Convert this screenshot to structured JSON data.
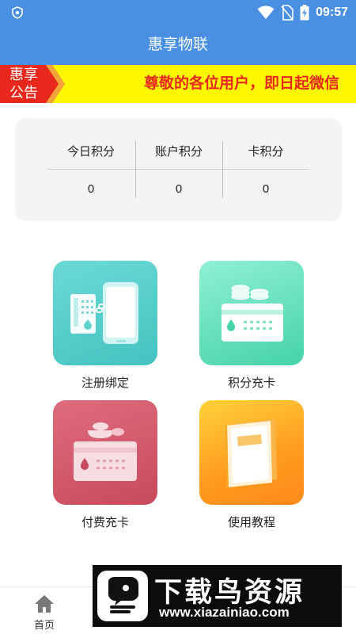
{
  "status_bar": {
    "time": "09:57"
  },
  "app": {
    "title": "惠享物联"
  },
  "notice": {
    "badge": "惠享 公告",
    "text": "尊敬的各位用户，即日起微信"
  },
  "points": {
    "columns": [
      {
        "label": "今日积分",
        "value": "0"
      },
      {
        "label": "账户积分",
        "value": "0"
      },
      {
        "label": "卡积分",
        "value": "0"
      }
    ]
  },
  "tiles": [
    {
      "label": "注册绑定"
    },
    {
      "label": "积分充卡"
    },
    {
      "label": "付费充卡"
    },
    {
      "label": "使用教程"
    }
  ],
  "bottom_nav": {
    "items": [
      {
        "label": "首页"
      }
    ]
  },
  "watermark": {
    "title": "下载鸟资源",
    "url": "www.xiazainiao.com"
  },
  "colors": {
    "primary": "#4a90e2",
    "notice_bg": "#fff700",
    "notice_text": "#e8281c",
    "badge_red": "#e8281c",
    "tile_register": "#5fd3cf",
    "tile_points": "#5fe0b8",
    "tile_pay": "#d45a6a",
    "tile_tutorial": "#ff9a1f"
  }
}
